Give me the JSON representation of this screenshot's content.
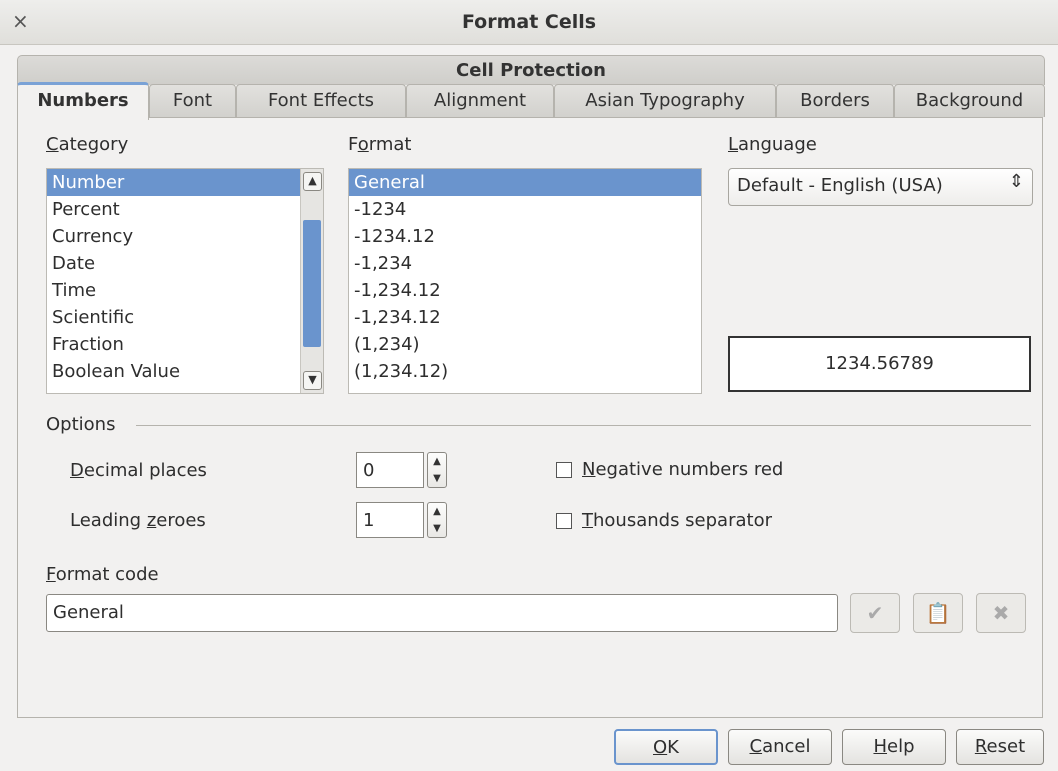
{
  "window": {
    "title": "Format Cells",
    "close_glyph": "×"
  },
  "tabs": {
    "top": "Cell Protection",
    "items": [
      "Numbers",
      "Font",
      "Font Effects",
      "Alignment",
      "Asian Typography",
      "Borders",
      "Background"
    ],
    "active": "Numbers"
  },
  "category": {
    "label_accel": "C",
    "label_rest": "ategory",
    "items": [
      "Number",
      "Percent",
      "Currency",
      "Date",
      "Time",
      "Scientific",
      "Fraction",
      "Boolean Value"
    ],
    "selected": "Number"
  },
  "format": {
    "label_pre": "F",
    "label_accel": "o",
    "label_rest": "rmat",
    "items": [
      "General",
      "-1234",
      "-1234.12",
      "-1,234",
      "-1,234.12",
      "-1,234.12",
      "(1,234)",
      "(1,234.12)"
    ],
    "selected": "General"
  },
  "language": {
    "label_accel": "L",
    "label_rest": "anguage",
    "value": "Default - English (USA)"
  },
  "preview": {
    "value": "1234.56789"
  },
  "options": {
    "heading": "Options",
    "decimal_places": {
      "label_accel": "D",
      "label_rest": "ecimal places",
      "value": "0"
    },
    "leading_zeroes": {
      "label_pre": "Leading ",
      "label_accel": "z",
      "label_rest": "eroes",
      "value": "1"
    },
    "negative_red": {
      "label_accel": "N",
      "label_rest": "egative numbers red",
      "checked": false
    },
    "thousands_sep": {
      "label_accel": "T",
      "label_rest": "housands separator",
      "checked": false
    }
  },
  "format_code": {
    "label_accel": "F",
    "label_rest": "ormat code",
    "value": "General"
  },
  "buttons": {
    "ok": {
      "accel": "O",
      "rest": "K"
    },
    "cancel": {
      "accel": "C",
      "rest": "ancel"
    },
    "help": {
      "accel": "H",
      "rest": "elp"
    },
    "reset": {
      "accel": "R",
      "rest": "eset"
    }
  },
  "colors": {
    "selection": "#6a94cd",
    "background": "#f2f1f0"
  }
}
